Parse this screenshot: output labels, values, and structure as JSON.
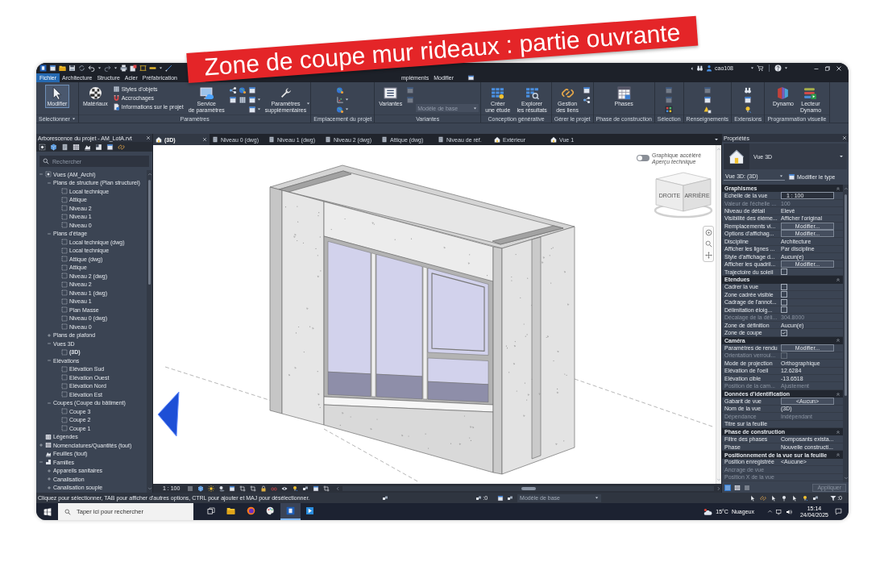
{
  "banner": {
    "text": "Zone de coupe mur rideaux : partie ouvrante"
  },
  "title_bar": {
    "user": "cao108"
  },
  "ribbon_tabs": [
    {
      "kind": "file",
      "label": "Fichier",
      "selected": false
    },
    {
      "kind": "tab",
      "label": "Architecture",
      "selected": false
    },
    {
      "kind": "tab",
      "label": "Structure",
      "selected": false
    },
    {
      "kind": "tab",
      "label": "Acier",
      "selected": false
    },
    {
      "kind": "tab",
      "label": "Préfabrication",
      "selected": false
    },
    {
      "kind": "tab",
      "label": "mpléments",
      "selected": false
    },
    {
      "kind": "tab",
      "label": "Modifier",
      "selected": false
    }
  ],
  "ribbon": {
    "panels": [
      {
        "title": "Sélectionner",
        "dropdown": true,
        "items": [
          {
            "kind": "large",
            "lines": [
              "Modifier"
            ],
            "selected": true
          }
        ]
      },
      {
        "title": "Paramètres",
        "dropdown": false,
        "items": [
          {
            "kind": "large",
            "lines": [
              "Matériaux"
            ]
          },
          {
            "kind": "stack",
            "entries": [
              {
                "label": "Styles d'objets"
              },
              {
                "label": "Accrochages"
              },
              {
                "label": "Informations sur le projet"
              }
            ]
          },
          {
            "kind": "large",
            "lines": [
              "Service",
              "de paramètres"
            ]
          },
          {
            "kind": "icons",
            "icons": [
              {
                "disabled": false,
                "dropdown": false
              },
              {
                "disabled": false,
                "dropdown": false
              }
            ]
          },
          {
            "kind": "icons",
            "icons": [
              {
                "disabled": false,
                "dropdown": false
              },
              {
                "disabled": false,
                "dropdown": false
              }
            ]
          },
          {
            "kind": "icons",
            "icons": [
              {
                "disabled": false,
                "dropdown": false
              },
              {
                "disabled": false,
                "dropdown": true
              },
              {
                "disabled": false,
                "dropdown": true
              }
            ]
          },
          {
            "kind": "large",
            "lines": [
              "Paramètres",
              "supplémentaires"
            ],
            "dropdown": true
          }
        ]
      },
      {
        "title": "Emplacement du projet",
        "dropdown": false,
        "items": [
          {
            "kind": "icons",
            "icons": [
              {
                "disabled": false,
                "dropdown": false
              },
              {
                "disabled": false,
                "dropdown": true
              },
              {
                "disabled": false,
                "dropdown": true
              }
            ]
          }
        ]
      },
      {
        "title": "Variantes",
        "dropdown": false,
        "items": [
          {
            "kind": "large",
            "lines": [
              "Variantes"
            ]
          },
          {
            "kind": "icons",
            "icons": [
              {
                "disabled": true,
                "dropdown": false
              },
              {
                "disabled": true,
                "dropdown": false
              }
            ]
          },
          {
            "kind": "dropdown",
            "value": "Modèle de base",
            "disabled": true
          }
        ]
      },
      {
        "title": "Conception générative",
        "dropdown": false,
        "items": [
          {
            "kind": "large",
            "lines": [
              "Créer",
              "une étude"
            ]
          },
          {
            "kind": "large",
            "lines": [
              "Explorer",
              "les résultats"
            ]
          }
        ]
      },
      {
        "title": "Gérer le projet",
        "dropdown": false,
        "items": [
          {
            "kind": "large",
            "lines": [
              "Gestion",
              "des liens"
            ]
          },
          {
            "kind": "icons",
            "icons": [
              {
                "disabled": false,
                "dropdown": false
              },
              {
                "disabled": false,
                "dropdown": false
              }
            ]
          }
        ]
      },
      {
        "title": "Phase de construction",
        "dropdown": false,
        "items": [
          {
            "kind": "large",
            "lines": [
              "Phases"
            ]
          }
        ]
      },
      {
        "title": "Sélection",
        "dropdown": false,
        "items": [
          {
            "kind": "icons",
            "icons": [
              {
                "disabled": true,
                "dropdown": false
              },
              {
                "disabled": true,
                "dropdown": false
              },
              {
                "disabled": false,
                "dropdown": false
              }
            ]
          }
        ]
      },
      {
        "title": "Renseignements",
        "dropdown": false,
        "items": [
          {
            "kind": "icons",
            "icons": [
              {
                "disabled": true,
                "dropdown": false
              },
              {
                "disabled": false,
                "dropdown": false
              },
              {
                "disabled": false,
                "dropdown": false
              }
            ]
          }
        ]
      },
      {
        "title": "Extensions",
        "dropdown": false,
        "items": [
          {
            "kind": "icons",
            "icons": [
              {
                "disabled": false,
                "dropdown": false
              },
              {
                "disabled": false,
                "dropdown": false
              },
              {
                "disabled": false,
                "dropdown": false
              }
            ]
          }
        ]
      },
      {
        "title": "Programmation visuelle",
        "dropdown": false,
        "items": [
          {
            "kind": "large",
            "lines": [
              "Dynamo"
            ]
          },
          {
            "kind": "large",
            "lines": [
              "Lecteur",
              "Dynamo"
            ]
          }
        ]
      }
    ]
  },
  "project_browser": {
    "title": "Arborescence du projet - AM_LotA.rvt",
    "search": {
      "placeholder": "Rechercher"
    },
    "tree": [
      {
        "label": "Vues (AM_Archi)",
        "expanded": true,
        "children": [
          {
            "label": "Plans de structure (Plan structurel)",
            "expanded": true,
            "children": [
              {
                "label": "Local technique"
              },
              {
                "label": "Attique"
              },
              {
                "label": "Niveau 2"
              },
              {
                "label": "Niveau 1"
              },
              {
                "label": "Niveau 0"
              }
            ]
          },
          {
            "label": "Plans d'étage",
            "expanded": true,
            "children": [
              {
                "label": "Local technique (dwg)"
              },
              {
                "label": "Local technique"
              },
              {
                "label": "Attique (dwg)"
              },
              {
                "label": "Attique"
              },
              {
                "label": "Niveau 2 (dwg)"
              },
              {
                "label": "Niveau 2"
              },
              {
                "label": "Niveau 1 (dwg)"
              },
              {
                "label": "Niveau 1"
              },
              {
                "label": "Plan Masse"
              },
              {
                "label": "Niveau 0 (dwg)"
              },
              {
                "label": "Niveau 0"
              }
            ]
          },
          {
            "label": "Plans de plafond",
            "expanded": false
          },
          {
            "label": "Vues 3D",
            "expanded": true,
            "children": [
              {
                "label": "(3D)",
                "current": true
              }
            ]
          },
          {
            "label": "Elévations",
            "expanded": true,
            "children": [
              {
                "label": "Elévation Sud"
              },
              {
                "label": "Elévation Ouest"
              },
              {
                "label": "Elévation Nord"
              },
              {
                "label": "Elévation Est"
              }
            ]
          },
          {
            "label": "Coupes (Coupe du bâtiment)",
            "expanded": true,
            "children": [
              {
                "label": "Coupe 3"
              },
              {
                "label": "Coupe 2"
              },
              {
                "label": "Coupe 1"
              }
            ]
          }
        ]
      },
      {
        "label": "Légendes"
      },
      {
        "label": "Nomenclatures/Quantités (tout)",
        "expanded": false
      },
      {
        "label": "Feuilles (tout)"
      },
      {
        "label": "Familles",
        "expanded": true,
        "children": [
          {
            "label": "Appareils sanitaires",
            "expanded": false
          },
          {
            "label": "Canalisation",
            "expanded": false
          },
          {
            "label": "Canalisation souple",
            "expanded": false
          }
        ]
      }
    ]
  },
  "view_tabs": [
    {
      "kind": "model",
      "label": "(3D)",
      "selected": true
    },
    {
      "kind": "plan",
      "label": "Niveau 0 (dwg)",
      "selected": false
    },
    {
      "kind": "plan",
      "label": "Niveau 1 (dwg)",
      "selected": false
    },
    {
      "kind": "plan",
      "label": "Niveau 2 (dwg)",
      "selected": false
    },
    {
      "kind": "plan",
      "label": "Attique (dwg)",
      "selected": false
    },
    {
      "kind": "plan",
      "label": "Niveau de réf.",
      "selected": false
    },
    {
      "kind": "model",
      "label": "Extérieur",
      "selected": false
    },
    {
      "kind": "model",
      "label": "Vue 1",
      "selected": false
    }
  ],
  "viewport": {
    "graphics_toggle": {
      "on": false,
      "label": "Graphique accéléré",
      "sublabel": "Aperçu technique"
    },
    "viewcube": {
      "left_face": "DROITE",
      "right_face": "ARRIÈRE"
    },
    "scale": "1 : 100"
  },
  "properties": {
    "title": "Propriétés",
    "type": "Vue 3D",
    "instance": "Vue 3D: (3D)",
    "edit_type": "Modifier le type",
    "sections": [
      {
        "title": "Graphismes",
        "expanded": true,
        "rows": [
          {
            "name": "Echelle de la vue",
            "kind": "input",
            "value": "1 : 100",
            "disabled": false
          },
          {
            "name": "Valeur de l'échelle ...",
            "kind": "text",
            "value": "100",
            "disabled": true
          },
          {
            "name": "Niveau de détail",
            "kind": "text",
            "value": "Elevé",
            "disabled": false
          },
          {
            "name": "Visibilité des éléme...",
            "kind": "text",
            "value": "Afficher l'original",
            "disabled": false
          },
          {
            "name": "Remplacements vi...",
            "kind": "button",
            "value": "Modifier...",
            "disabled": false
          },
          {
            "name": "Options d'affichag...",
            "kind": "button",
            "value": "Modifier...",
            "disabled": false
          },
          {
            "name": "Discipline",
            "kind": "text",
            "value": "Architecture",
            "disabled": false
          },
          {
            "name": "Afficher les lignes ...",
            "kind": "text",
            "value": "Par discipline",
            "disabled": false
          },
          {
            "name": "Style d'affichage d...",
            "kind": "text",
            "value": "Aucun(e)",
            "disabled": false
          },
          {
            "name": "Afficher les quadril...",
            "kind": "button",
            "value": "Modifier...",
            "disabled": false
          },
          {
            "name": "Trajectoire du soleil",
            "kind": "checkbox",
            "checked": false,
            "disabled": false
          }
        ]
      },
      {
        "title": "Etendues",
        "expanded": true,
        "rows": [
          {
            "name": "Cadrer la vue",
            "kind": "checkbox",
            "checked": false,
            "disabled": false
          },
          {
            "name": "Zone cadrée visible",
            "kind": "checkbox",
            "checked": false,
            "disabled": false
          },
          {
            "name": "Cadrage de l'annot...",
            "kind": "checkbox",
            "checked": false,
            "disabled": false
          },
          {
            "name": "Délimitation éloig...",
            "kind": "checkbox",
            "checked": false,
            "disabled": false
          },
          {
            "name": "Décalage de la déli...",
            "kind": "text",
            "value": "304.8000",
            "disabled": true
          },
          {
            "name": "Zone de définition",
            "kind": "text",
            "value": "Aucun(e)",
            "disabled": false
          },
          {
            "name": "Zone de coupe",
            "kind": "checkbox",
            "checked": true,
            "disabled": false
          }
        ]
      },
      {
        "title": "Caméra",
        "expanded": true,
        "rows": [
          {
            "name": "Paramètres de rendu",
            "kind": "button",
            "value": "Modifier...",
            "disabled": false
          },
          {
            "name": "Orientation verroui...",
            "kind": "checkbox",
            "checked": false,
            "disabled": true
          },
          {
            "name": "Mode de projection",
            "kind": "text",
            "value": "Orthographique",
            "disabled": false
          },
          {
            "name": "Elévation de l'oeil",
            "kind": "text",
            "value": "12.6284",
            "disabled": false
          },
          {
            "name": "Elévation cible",
            "kind": "text",
            "value": "-13.6518",
            "disabled": false
          },
          {
            "name": "Position de la cam...",
            "kind": "text",
            "value": "Ajustement",
            "disabled": true
          }
        ]
      },
      {
        "title": "Données d'identification",
        "expanded": true,
        "rows": [
          {
            "name": "Gabarit de vue",
            "kind": "button",
            "value": "<Aucun>",
            "disabled": false
          },
          {
            "name": "Nom de la vue",
            "kind": "text",
            "value": "(3D)",
            "disabled": false
          },
          {
            "name": "Dépendance",
            "kind": "text",
            "value": "Indépendant",
            "disabled": true
          },
          {
            "name": "Titre sur la feuille",
            "kind": "text",
            "disabled": false
          }
        ]
      },
      {
        "title": "Phase de construction",
        "expanded": true,
        "rows": [
          {
            "name": "Filtre des phases",
            "kind": "text",
            "value": "Composants exista...",
            "disabled": false
          },
          {
            "name": "Phase",
            "kind": "text",
            "value": "Nouvelle constructi...",
            "disabled": false
          }
        ]
      },
      {
        "title": "Positionnement de la vue sur la feuille",
        "expanded": true,
        "rows": [
          {
            "name": "Position enregistrée",
            "kind": "text",
            "value": "<Aucune>",
            "disabled": false
          },
          {
            "name": "Ancrage de vue",
            "kind": "text",
            "disabled": true
          },
          {
            "name": "Position X de la vue",
            "kind": "text",
            "disabled": true
          }
        ]
      }
    ],
    "apply": {
      "label": "Appliquer",
      "disabled": true
    }
  },
  "status_bar": {
    "message": "Cliquez pour sélectionner, TAB pour afficher d'autres options, CTRL pour ajouter et MAJ pour désélectionner.",
    "workset_count": ":0",
    "design_option": "Modèle de base",
    "selection_count": ":0"
  },
  "taskbar": {
    "search": {
      "placeholder": "Taper ici pour rechercher"
    },
    "apps": [
      {
        "selected": false
      },
      {
        "selected": false
      },
      {
        "selected": false
      },
      {
        "selected": true
      },
      {
        "selected": false
      }
    ],
    "temperature": "15°C",
    "weather": "Nuageux",
    "time": "15:14",
    "date": "24/04/2025"
  }
}
